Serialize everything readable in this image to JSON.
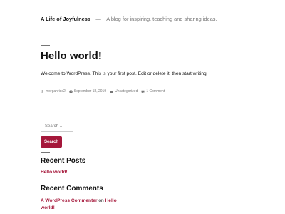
{
  "site": {
    "title": "A Life of Joyfulness",
    "separator": "—",
    "description": "A blog for inspiring, teaching and sharing ideas."
  },
  "post": {
    "title": "Hello world!",
    "body": "Welcome to WordPress. This is your first post. Edit or delete it, then start writing!",
    "meta": {
      "author": "morganrise2",
      "date": "September 18, 2019",
      "category": "Uncategorized",
      "comments": "1 Comment"
    }
  },
  "search": {
    "placeholder": "Search …",
    "button_label": "Search"
  },
  "recent_posts": {
    "heading": "Recent Posts",
    "items": [
      {
        "label": "Hello world!"
      }
    ]
  },
  "recent_comments": {
    "heading": "Recent Comments",
    "items": [
      {
        "author": "A WordPress Commenter",
        "connector": "on",
        "post": "Hello world!"
      }
    ]
  },
  "colors": {
    "accent": "#a5173a",
    "muted": "#767676",
    "text": "#111111"
  }
}
